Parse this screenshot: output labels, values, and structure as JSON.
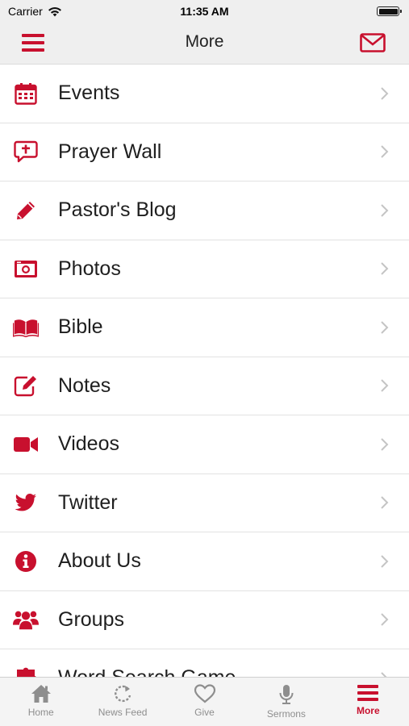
{
  "status": {
    "carrier": "Carrier",
    "time": "11:35 AM"
  },
  "header": {
    "title": "More",
    "menu_icon": "hamburger-icon",
    "mail_icon": "envelope-icon"
  },
  "colors": {
    "accent": "#c8102e",
    "inactive": "#8e8e8e",
    "bar_bg": "#efefef"
  },
  "menu": [
    {
      "label": "Events",
      "icon": "calendar-icon"
    },
    {
      "label": "Prayer Wall",
      "icon": "prayer-bubble-icon"
    },
    {
      "label": "Pastor's Blog",
      "icon": "pencil-icon"
    },
    {
      "label": "Photos",
      "icon": "camera-icon"
    },
    {
      "label": "Bible",
      "icon": "book-icon"
    },
    {
      "label": "Notes",
      "icon": "edit-note-icon"
    },
    {
      "label": "Videos",
      "icon": "video-camera-icon"
    },
    {
      "label": "Twitter",
      "icon": "twitter-bird-icon"
    },
    {
      "label": "About Us",
      "icon": "info-icon"
    },
    {
      "label": "Groups",
      "icon": "users-icon"
    },
    {
      "label": "Word Search Game",
      "icon": "puzzle-icon"
    }
  ],
  "tabs": [
    {
      "label": "Home",
      "icon": "home-icon"
    },
    {
      "label": "News Feed",
      "icon": "refresh-icon"
    },
    {
      "label": "Give",
      "icon": "heart-icon"
    },
    {
      "label": "Sermons",
      "icon": "microphone-icon"
    },
    {
      "label": "More",
      "icon": "hamburger-icon",
      "active": true
    }
  ]
}
